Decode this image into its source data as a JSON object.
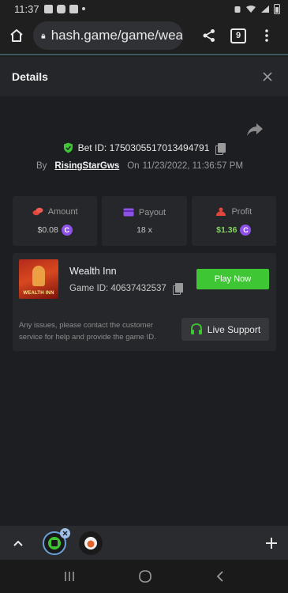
{
  "status_bar": {
    "time": "11:37"
  },
  "browser": {
    "url": "hash.game/game/wea",
    "tab_count": "9"
  },
  "details": {
    "title": "Details"
  },
  "bet": {
    "id_label": "Bet ID: 1750305517013494791",
    "by_label": "By",
    "username": "RisingStarGws",
    "on_label": "On",
    "datetime": "11/23/2022, 11:36:57 PM"
  },
  "stats": [
    {
      "label": "Amount",
      "value": "$0.08",
      "color": "#e2453c"
    },
    {
      "label": "Payout",
      "value": "18 x",
      "color": "#8e52e8"
    },
    {
      "label": "Profit",
      "value": "$1.36",
      "color": "#e2453c"
    }
  ],
  "game": {
    "thumb_text": "WEALTH INN",
    "name": "Wealth Inn",
    "id_label": "Game ID: 40637432537",
    "play_label": "Play Now",
    "issues_text": "Any issues, please contact the customer service for help and provide the game ID.",
    "support_label": "Live Support"
  },
  "colors": {
    "accent_green": "#3fc634",
    "profit_green": "#7ed957",
    "coin_purple": "#8e52e8"
  }
}
